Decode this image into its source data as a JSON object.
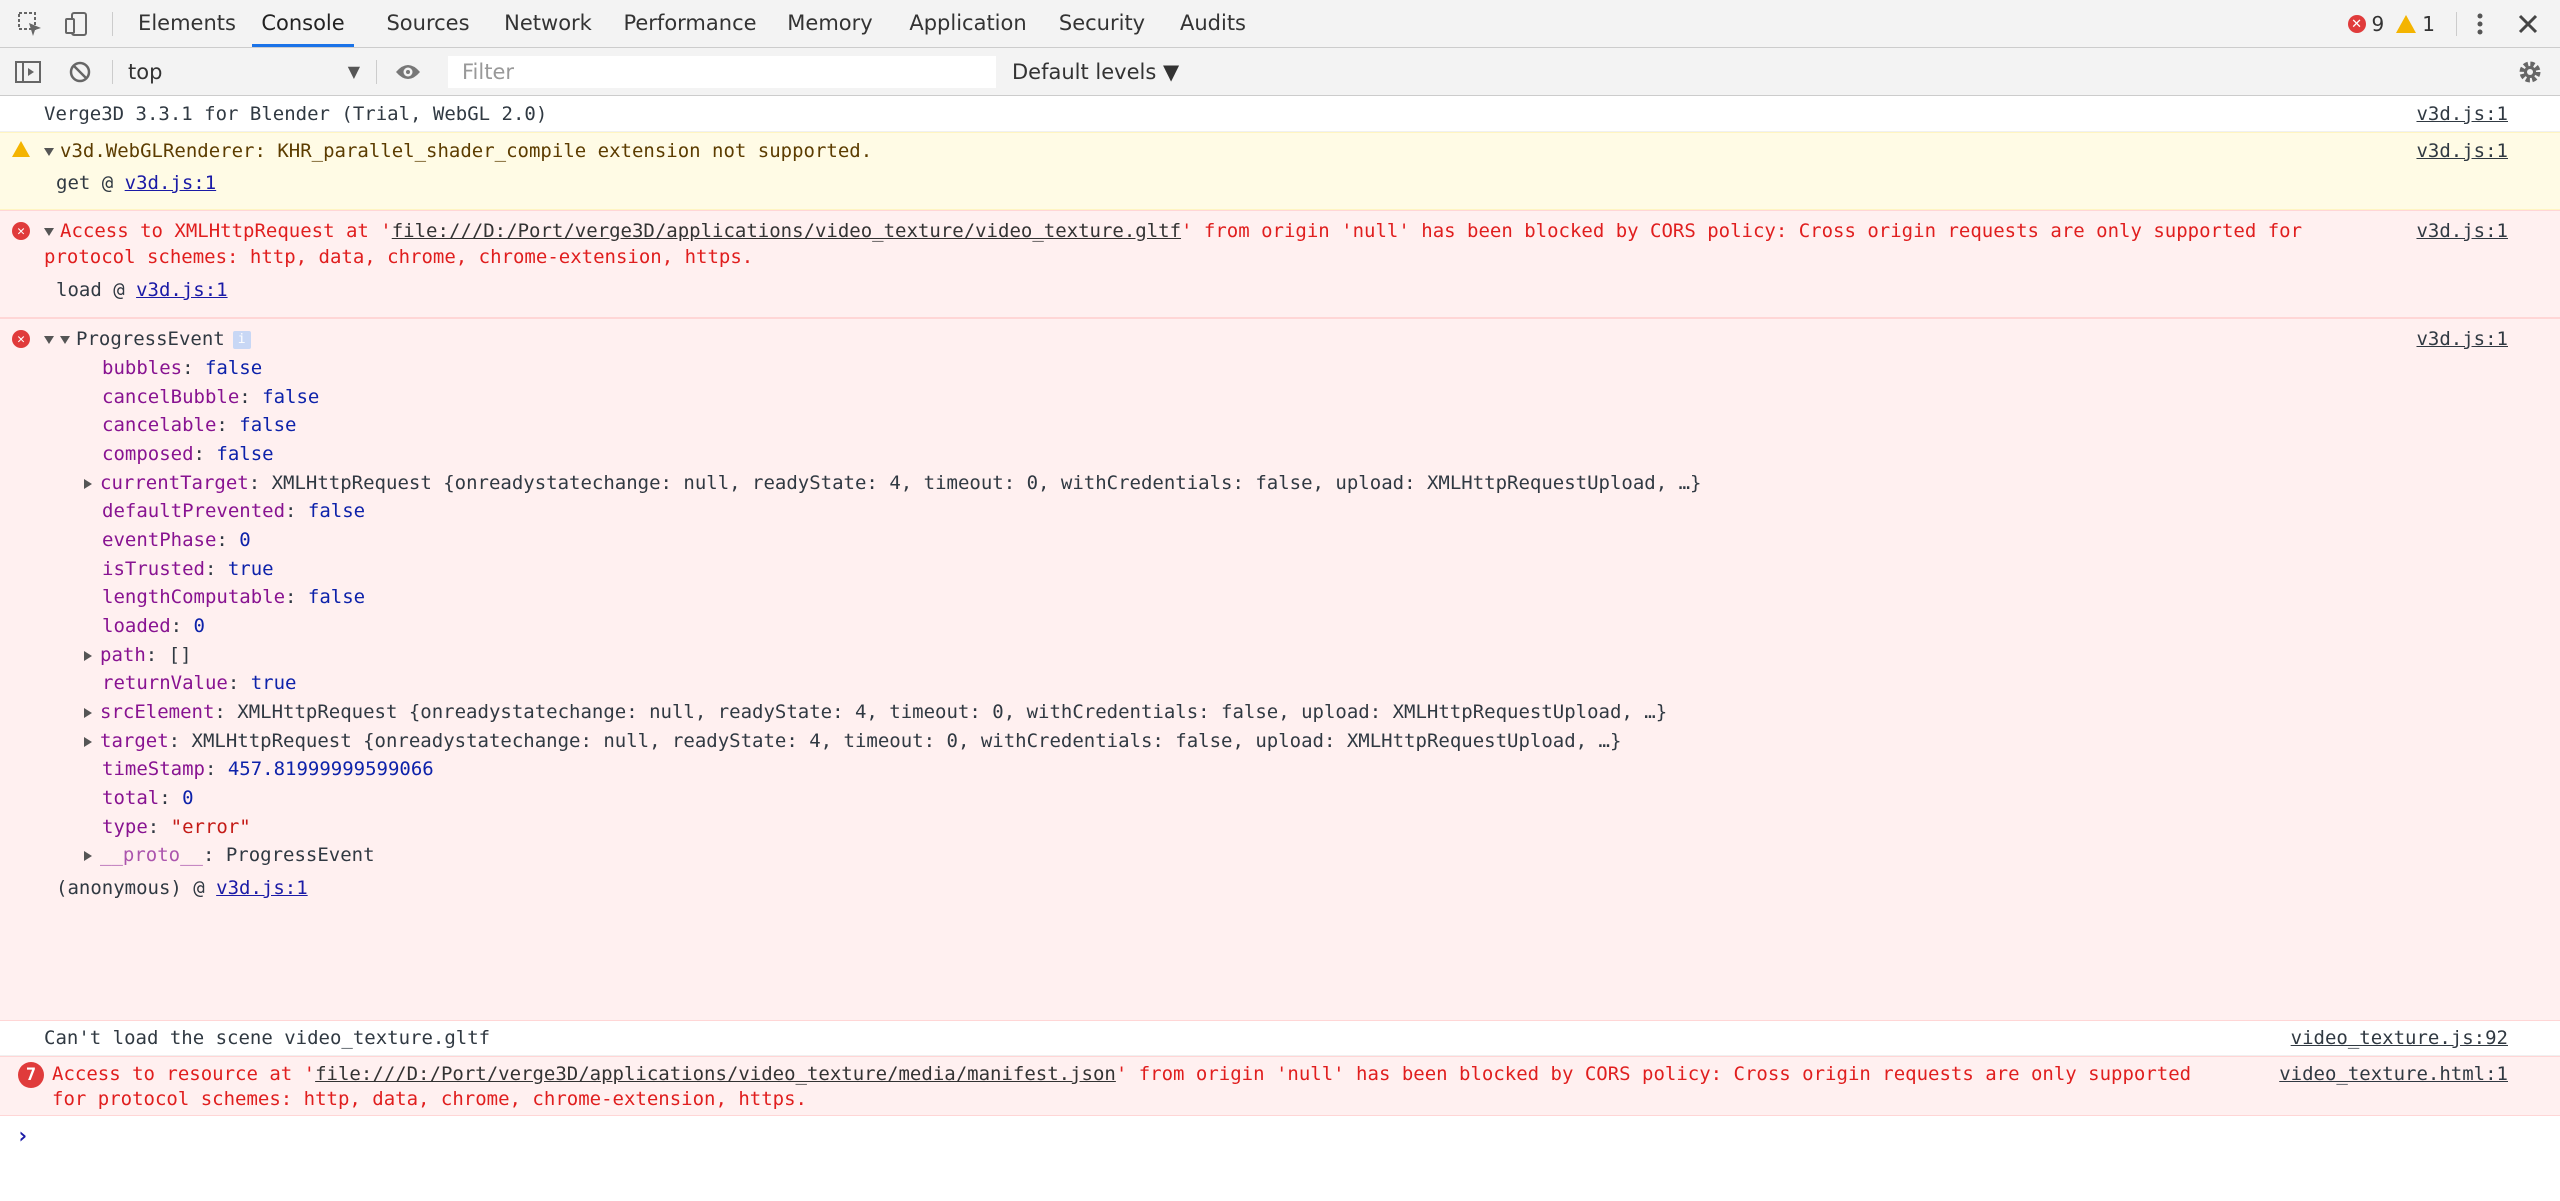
{
  "tabs": [
    "Elements",
    "Console",
    "Sources",
    "Network",
    "Performance",
    "Memory",
    "Application",
    "Security",
    "Audits"
  ],
  "counts": {
    "errors": "9",
    "warnings": "1"
  },
  "toolbar": {
    "context": "top",
    "filter_placeholder": "Filter",
    "levels": "Default levels ▼"
  },
  "messages": {
    "m1": {
      "text": "Verge3D 3.3.1 for Blender (Trial, WebGL 2.0)",
      "source": "v3d.js:1"
    },
    "m2": {
      "text": "v3d.WebGLRenderer: KHR_parallel_shader_compile extension not supported.",
      "stack_fn": "get @ ",
      "stack_link": "v3d.js:1",
      "source": "v3d.js:1"
    },
    "m3": {
      "pre": "Access to XMLHttpRequest at '",
      "url": "file:///D:/Port/verge3D/applications/video_texture/video_texture.gltf",
      "post": "' from origin 'null' has been blocked by CORS policy: Cross origin requests are only supported for",
      "line2": "protocol schemes: http, data, chrome, chrome-extension, https.",
      "stack_fn": "load @ ",
      "stack_link": "v3d.js:1",
      "source": "v3d.js:1"
    },
    "m4": {
      "title": "ProgressEvent",
      "source": "v3d.js:1",
      "bubbles": "false",
      "cancelBubble": "false",
      "cancelable": "false",
      "composed": "false",
      "currentTarget": "XMLHttpRequest {onreadystatechange: null, readyState: 4, timeout: 0, withCredentials: false, upload: XMLHttpRequestUpload, …}",
      "defaultPrevented": "false",
      "eventPhase": "0",
      "isTrusted": "true",
      "lengthComputable": "false",
      "loaded": "0",
      "path": "[]",
      "returnValue": "true",
      "srcElement": "XMLHttpRequest {onreadystatechange: null, readyState: 4, timeout: 0, withCredentials: false, upload: XMLHttpRequestUpload, …}",
      "target": "XMLHttpRequest {onreadystatechange: null, readyState: 4, timeout: 0, withCredentials: false, upload: XMLHttpRequestUpload, …}",
      "timeStamp": "457.81999999599066",
      "total": "0",
      "type": "\"error\"",
      "proto": "ProgressEvent",
      "stack_fn": "(anonymous) @ ",
      "stack_link": "v3d.js:1"
    },
    "m5": {
      "text": "Can't load the scene video_texture.gltf",
      "source": "video_texture.js:92"
    },
    "m6": {
      "count": "7",
      "pre": "Access to resource at '",
      "url": "file:///D:/Port/verge3D/applications/video_texture/media/manifest.json",
      "post": "' from origin 'null' has been blocked by CORS policy: Cross origin requests are only supported",
      "line2": "for protocol schemes: http, data, chrome, chrome-extension, https.",
      "source": "video_texture.html:1"
    }
  },
  "prompt": "›"
}
